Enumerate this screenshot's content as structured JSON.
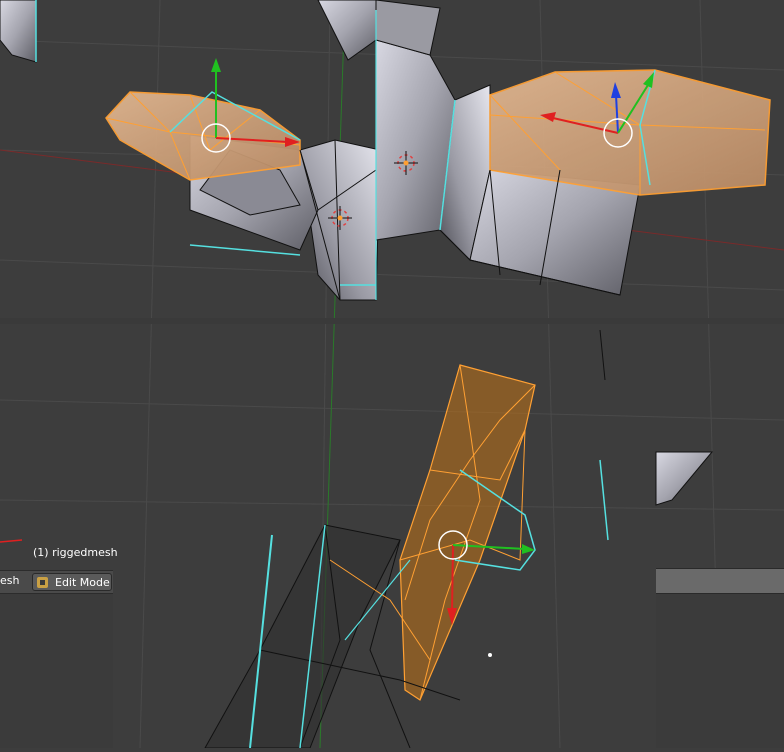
{
  "viewport": {
    "object_label": "(1) riggedmesh",
    "header_fragment": "esh",
    "mode_button": {
      "label": "Edit Mode",
      "icon": "edit-mode-icon"
    }
  },
  "colors": {
    "background": "#3d3d3d",
    "grid": "#4a4a4a",
    "selected_face": "#e8962e",
    "selected_edge": "#ffa033",
    "mesh_face": "#b4b4be",
    "wire": "#111111",
    "seam": "#55e0e0",
    "axis_x": "#e02020",
    "axis_y": "#20c020",
    "axis_z": "#2040e0",
    "cursor": "#ffffff"
  },
  "icons": [
    "translate-manipulator-icon",
    "3d-cursor-icon",
    "edit-mode-icon"
  ]
}
